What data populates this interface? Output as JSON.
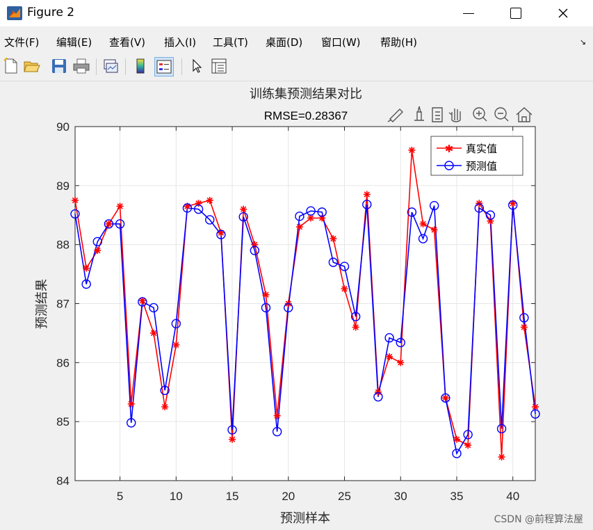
{
  "window": {
    "title": "Figure 2",
    "minimize_symbol": "—",
    "maximize_symbol": "☐",
    "close_symbol": "✕"
  },
  "menu": [
    {
      "label": "文件(F)"
    },
    {
      "label": "编辑(E)"
    },
    {
      "label": "查看(V)"
    },
    {
      "label": "插入(I)"
    },
    {
      "label": "工具(T)"
    },
    {
      "label": "桌面(D)"
    },
    {
      "label": "窗口(W)"
    },
    {
      "label": "帮助(H)"
    }
  ],
  "menu_arrow": "↘",
  "toolbar": [
    "new-figure-icon",
    "open-file-icon",
    "save-icon",
    "print-icon",
    "link-plot-icon",
    "colorbar-icon",
    "legend-icon",
    "pointer-icon",
    "property-inspector-icon"
  ],
  "axes_toolbar": [
    "brush-icon",
    "data-cursor-icon",
    "restore-icon",
    "pan-icon",
    "zoom-in-icon",
    "zoom-out-icon",
    "home-icon"
  ],
  "footer_credit": "CSDN @前程算法屋",
  "chart_data": {
    "type": "line",
    "title": "训练集预测结果对比",
    "subtitle": "RMSE=0.28367",
    "xlabel": "预测样本",
    "ylabel": "预测结果",
    "xlim": [
      1,
      42
    ],
    "ylim": [
      84,
      90
    ],
    "xticks": [
      5,
      10,
      15,
      20,
      25,
      30,
      35,
      40
    ],
    "yticks": [
      84,
      85,
      86,
      87,
      88,
      89,
      90
    ],
    "grid": true,
    "legend_position": "top-right",
    "x": [
      1,
      2,
      3,
      4,
      5,
      6,
      7,
      8,
      9,
      10,
      11,
      12,
      13,
      14,
      15,
      16,
      17,
      18,
      19,
      20,
      21,
      22,
      23,
      24,
      25,
      26,
      27,
      28,
      29,
      30,
      31,
      32,
      33,
      34,
      35,
      36,
      37,
      38,
      39,
      40,
      41,
      42
    ],
    "series": [
      {
        "name": "真实值",
        "color": "#ff0000",
        "marker": "star",
        "values": [
          88.75,
          87.6,
          87.9,
          88.35,
          88.65,
          85.3,
          87.05,
          86.5,
          85.25,
          86.3,
          88.65,
          88.7,
          88.75,
          88.2,
          84.7,
          88.6,
          88.0,
          87.15,
          85.1,
          87.0,
          88.3,
          88.45,
          88.45,
          88.1,
          87.25,
          86.6,
          88.85,
          85.5,
          86.1,
          86.0,
          89.6,
          88.35,
          88.25,
          85.4,
          84.7,
          84.6,
          88.7,
          88.4,
          84.4,
          88.7,
          86.6,
          85.25
        ]
      },
      {
        "name": "预测值",
        "color": "#0000ff",
        "marker": "circle",
        "values": [
          88.52,
          87.33,
          88.05,
          88.35,
          88.35,
          84.98,
          87.03,
          86.93,
          85.53,
          86.66,
          88.62,
          88.6,
          88.42,
          88.17,
          84.86,
          88.47,
          87.9,
          86.93,
          84.83,
          86.93,
          88.48,
          88.57,
          88.55,
          87.7,
          87.63,
          86.78,
          88.68,
          85.42,
          86.42,
          86.34,
          88.55,
          88.1,
          88.66,
          85.4,
          84.46,
          84.78,
          88.62,
          88.5,
          84.88,
          88.67,
          86.76,
          85.13
        ]
      }
    ]
  }
}
